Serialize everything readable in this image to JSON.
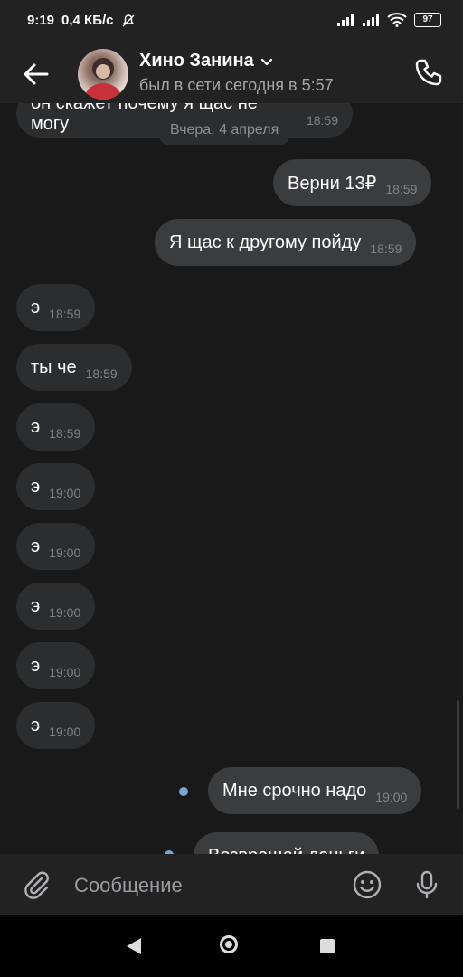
{
  "status": {
    "time": "9:19",
    "speed": "0,4 КБ/с",
    "battery": "97"
  },
  "header": {
    "name": "Хино Занина",
    "status": "был в сети сегодня в 5:57"
  },
  "chat": {
    "top_partial": {
      "text": "он скажет почему я щас не могу",
      "time": "18:59"
    },
    "date_label": "Вчера, 4 апреля",
    "messages": [
      {
        "dir": "out",
        "text": "Верни 13₽",
        "time": "18:59"
      },
      {
        "dir": "out",
        "text": "Я щас к другому пойду",
        "time": "18:59"
      },
      {
        "dir": "in",
        "text": "э",
        "time": "18:59"
      },
      {
        "dir": "in",
        "text": "ты че",
        "time": "18:59"
      },
      {
        "dir": "in",
        "text": "э",
        "time": "18:59"
      },
      {
        "dir": "in",
        "text": "э",
        "time": "19:00"
      },
      {
        "dir": "in",
        "text": "э",
        "time": "19:00"
      },
      {
        "dir": "in",
        "text": "э",
        "time": "19:00"
      },
      {
        "dir": "in",
        "text": "э",
        "time": "19:00"
      },
      {
        "dir": "in",
        "text": "э",
        "time": "19:00"
      },
      {
        "dir": "out",
        "text": "Мне срочно надо",
        "time": "19:00"
      },
      {
        "dir": "out",
        "text": "Возвращай деньги",
        "time": ""
      }
    ]
  },
  "composer": {
    "placeholder": "Сообщение"
  }
}
